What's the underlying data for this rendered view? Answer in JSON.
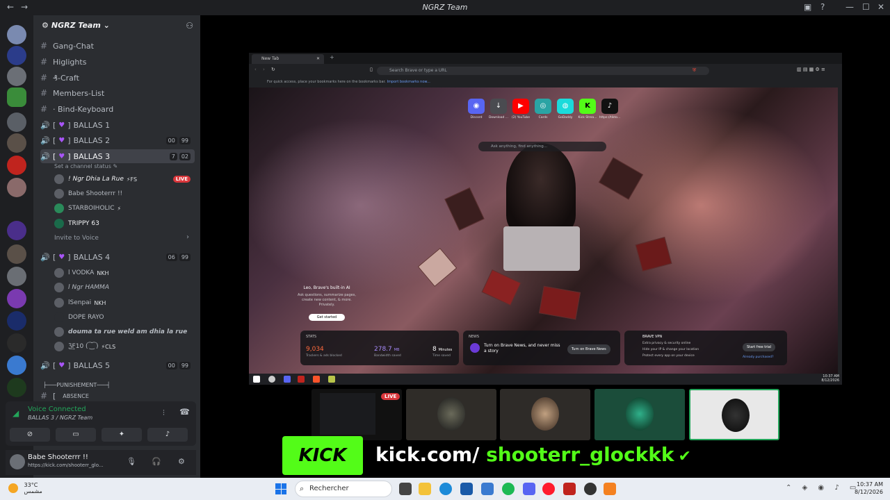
{
  "app": {
    "window_title": "NGRZ Team",
    "back": "←",
    "forward": "→"
  },
  "server": {
    "name": "NGRZ Team",
    "channels": [
      {
        "label": "Gang-Chat"
      },
      {
        "label": "Higlights"
      },
      {
        "label": "₰-Craft"
      },
      {
        "label": "Members-List"
      },
      {
        "label": "· Bind-Keyboard"
      }
    ],
    "voice_channels": [
      {
        "label": "BALLAS 1",
        "counts": []
      },
      {
        "label": "BALLAS 2",
        "counts": [
          "00",
          "99"
        ]
      },
      {
        "label": "BALLAS 3",
        "counts": [
          "7",
          "02"
        ]
      },
      {
        "label": "BALLAS 4",
        "counts": [
          "06",
          "99"
        ]
      },
      {
        "label": "BALLAS 5",
        "counts": [
          "00",
          "99"
        ]
      }
    ],
    "ballas3_status": "Set a channel status ✎",
    "ballas3_members": [
      {
        "name": "! Ngr Dhia La Rue",
        "tag": "⚡FS",
        "live": "LIVE"
      },
      {
        "name": "Babe Shooterrr !!",
        "tag": "",
        "live": ""
      },
      {
        "name": "STARBOIHOLIC",
        "tag": "⚡",
        "live": ""
      },
      {
        "name": "TRIPPY 63",
        "tag": "",
        "live": ""
      }
    ],
    "invite": "Invite to Voice",
    "ballas4_members": [
      {
        "name": "l VODKA",
        "tag": "NKH"
      },
      {
        "name": "l Ngr HAMMA",
        "tag": ""
      },
      {
        "name": "lSenpai",
        "tag": "NKH"
      },
      {
        "name": "DOPE RAYO",
        "tag": ""
      },
      {
        "name": "douma ta rue weld am dhia la rue",
        "tag": ""
      },
      {
        "name": "ℨ͢F10 ( ͡ ͜ ͡ )",
        "tag": "⚡CLS"
      }
    ],
    "punishment": "PUNISHEMENT",
    "absence": "ABSENCE"
  },
  "voice_connected": {
    "title": "Voice Connected",
    "sub": "BALLAS 3 / NGRZ Team"
  },
  "user": {
    "name": "Babe Shooterrr !!",
    "status": "https://kick.com/shooterr_glo..."
  },
  "browser": {
    "tab_title": "New Tab",
    "address_placeholder": "Search Brave or type a URL",
    "bookmarks_hint": "For quick access, place your bookmarks here on the bookmarks bar.",
    "bookmarks_link": "Import bookmarks now...",
    "shortcuts": [
      {
        "label": "Discord",
        "icon": "discord-icon",
        "color": "#5865f2"
      },
      {
        "label": "Download ...",
        "icon": "download-icon",
        "color": "#4a4b50"
      },
      {
        "label": "(2) YouTube",
        "icon": "youtube-icon",
        "color": "#ff0000"
      },
      {
        "label": "Cards",
        "icon": "cards-icon",
        "color": "#2aa4a4"
      },
      {
        "label": "GoDaddy",
        "icon": "godaddy-icon",
        "color": "#1bdbdb"
      },
      {
        "label": "Kick Strea...",
        "icon": "kick-icon",
        "color": "#53fc18"
      },
      {
        "label": "https://tikto...",
        "icon": "tiktok-icon",
        "color": "#111111"
      }
    ],
    "ask_placeholder": "Ask anything, find anything...",
    "leo": {
      "title": "Leo, Brave's built-in AI",
      "desc": "Ask questions, summarize pages, create new content, & more. Privately.",
      "button": "Get started"
    },
    "stats": {
      "header": "STATS",
      "trackers": "9,034",
      "trackers_label": "Trackers & ads blocked",
      "bandwidth": "278.7",
      "bandwidth_unit": "MB",
      "bandwidth_label": "Bandwidth saved",
      "time": "8",
      "time_unit": "Minutes",
      "time_label": "Time saved"
    },
    "news": {
      "header": "NEWS",
      "text": "Turn on Brave News, and never miss a story",
      "button": "Turn on Brave News"
    },
    "vpn": {
      "header": "BRAVE VPN",
      "items": [
        "Extra privacy & security online",
        "Hide your IP & change your location",
        "Protect every app on your device"
      ],
      "button": "Start free trial",
      "link": "Already purchased?"
    },
    "clock": "10:37 AM\n8/12/2026"
  },
  "stream_tiles": {
    "live": "LIVE"
  },
  "kick": {
    "logo": "KICK",
    "url_prefix": "kick.com/",
    "url_handle": "shooterr_glockkk",
    "check": "✔"
  },
  "taskbar": {
    "temp": "33°C",
    "weather": "مشمس",
    "search": "Rechercher",
    "time": "10:37 AM",
    "date": "8/12/2026"
  },
  "colors": {
    "discord_bg": "#2b2d31",
    "voice_green": "#23a55a",
    "kick_green": "#53fc18",
    "live_red": "#da373c"
  }
}
